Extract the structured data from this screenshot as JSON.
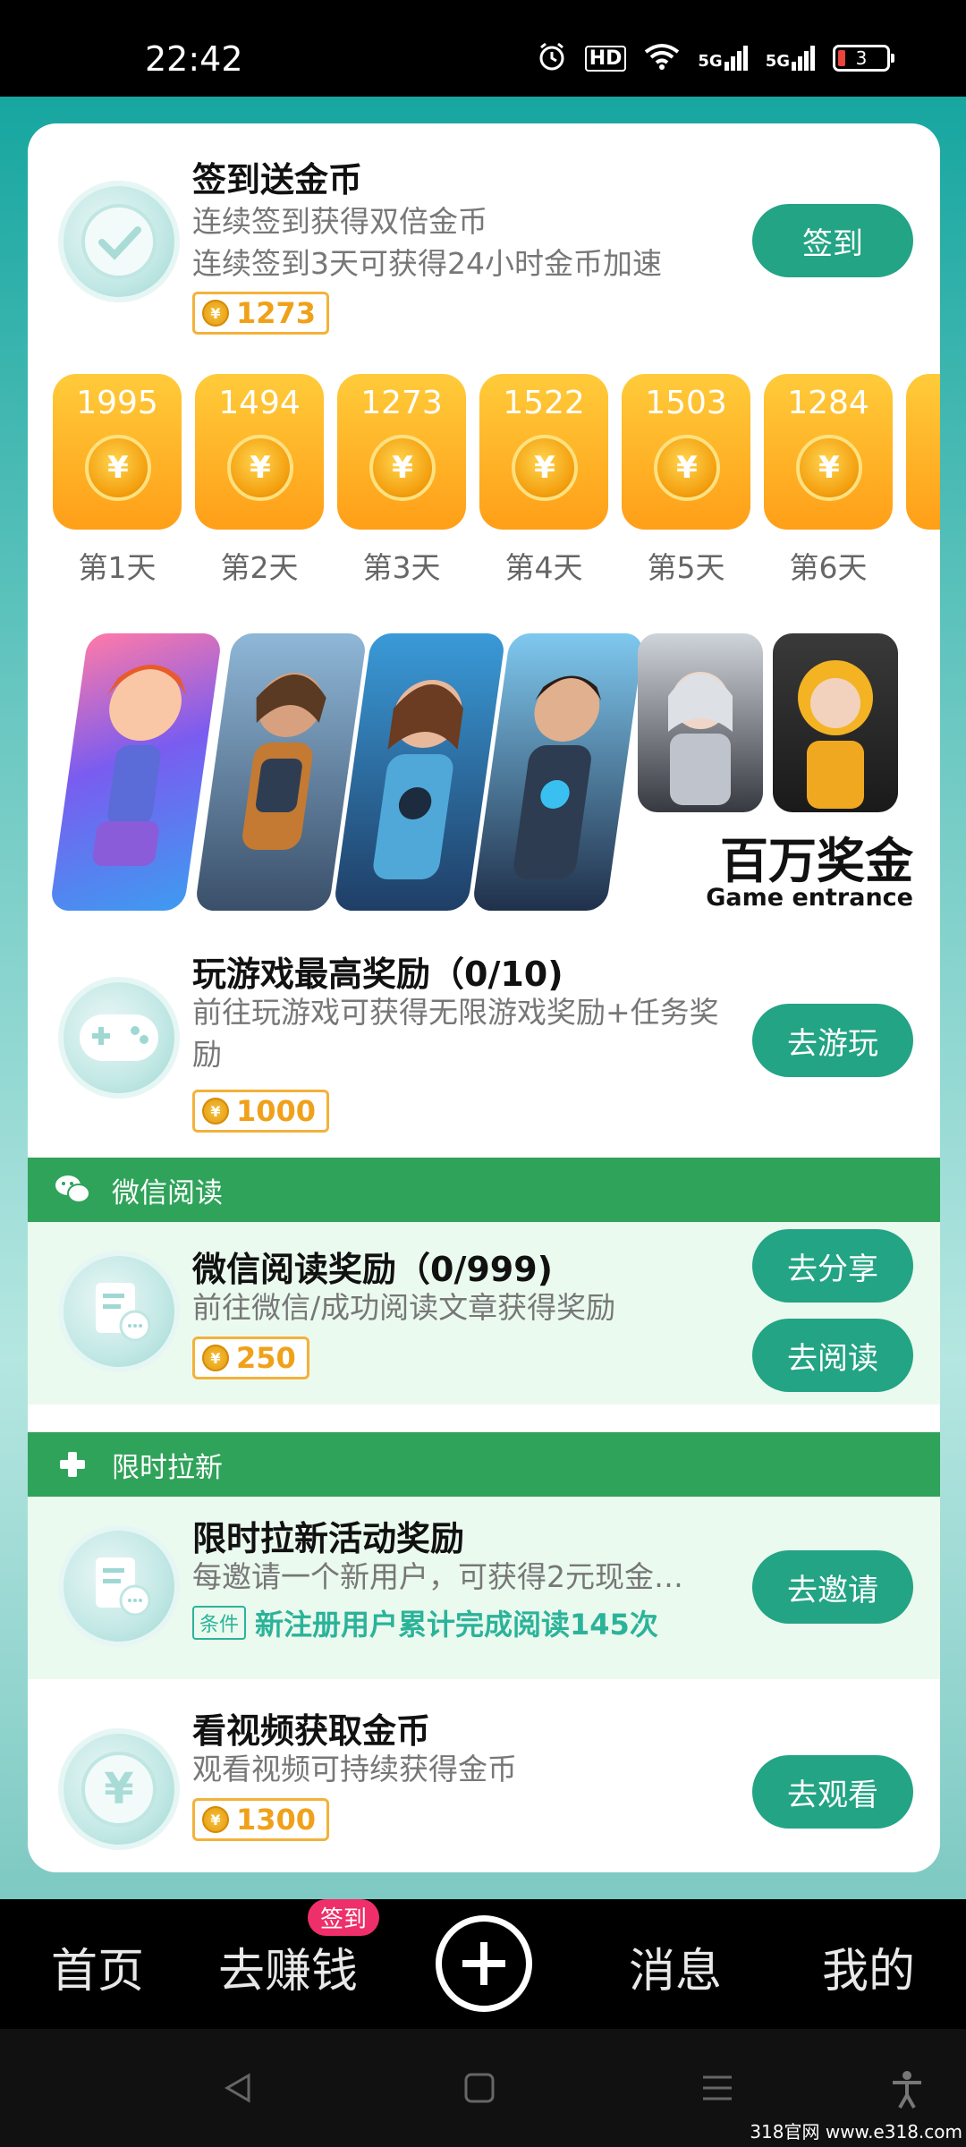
{
  "status": {
    "time": "22:42",
    "hd": "HD",
    "sig1": "5G",
    "sig2": "5G",
    "battery": "3"
  },
  "checkin": {
    "title": "签到送金币",
    "desc1": "连续签到获得双倍金币",
    "desc2": "连续签到3天可获得24小时金币加速",
    "coins": "1273",
    "button": "签到"
  },
  "days": [
    {
      "amount": "1995",
      "label": "第1天"
    },
    {
      "amount": "1494",
      "label": "第2天"
    },
    {
      "amount": "1273",
      "label": "第3天"
    },
    {
      "amount": "1522",
      "label": "第4天"
    },
    {
      "amount": "1503",
      "label": "第5天"
    },
    {
      "amount": "1284",
      "label": "第6天"
    }
  ],
  "coin_symbol": "¥",
  "banner": {
    "title": "百万奖金",
    "subtitle": "Game entrance"
  },
  "game_task": {
    "title": "玩游戏最高奖励（0/10)",
    "desc": "前往玩游戏可获得无限游戏奖励+任务奖励",
    "coins": "1000",
    "button": "去游玩"
  },
  "wechat_section": {
    "header": "微信阅读",
    "title": "微信阅读奖励（0/999)",
    "desc": "前往微信/成功阅读文章获得奖励",
    "coins": "250",
    "button_share": "去分享",
    "button_read": "去阅读"
  },
  "invite_section": {
    "header": "限时拉新",
    "title": "限时拉新活动奖励",
    "desc": "每邀请一个新用户，可获得2元现金…",
    "condition_tag": "条件",
    "condition_text": "新注册用户累计完成阅读145次",
    "button": "去邀请"
  },
  "video_task": {
    "title": "看视频获取金币",
    "desc": "观看视频可持续获得金币",
    "coins": "1300",
    "button": "去观看",
    "icon_symbol": "¥"
  },
  "bottom_nav": {
    "home": "首页",
    "earn": "去赚钱",
    "earn_badge": "签到",
    "messages": "消息",
    "mine": "我的"
  },
  "watermark": "318官网 www.e318.com",
  "colors": {
    "accent_green": "#23a484",
    "section_green": "#2fa35a",
    "coin_orange": "#f0a11a",
    "badge_pink": "#ee2f6a"
  }
}
